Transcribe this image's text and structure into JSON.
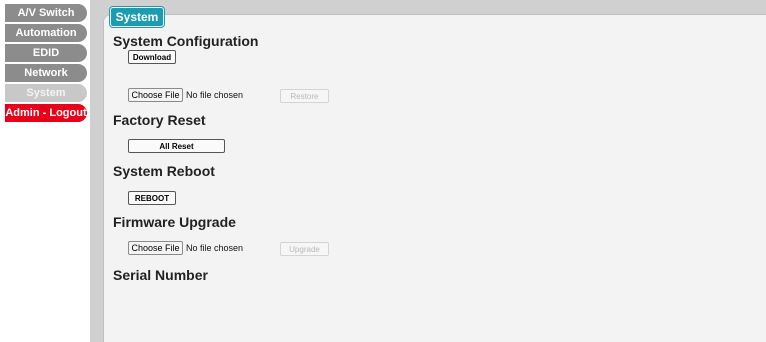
{
  "sidebar": {
    "items": [
      {
        "label": "A/V Switch"
      },
      {
        "label": "Automation"
      },
      {
        "label": "EDID"
      },
      {
        "label": "Network"
      },
      {
        "label": "System"
      },
      {
        "label": "Admin - Logout"
      }
    ]
  },
  "page": {
    "tab_title": "System"
  },
  "system_configuration": {
    "heading": "System Configuration",
    "download_label": "Download",
    "choose_file_label": "Choose File",
    "file_status": "No file chosen",
    "restore_label": "Restore"
  },
  "factory_reset": {
    "heading": "Factory Reset",
    "all_reset_label": "All Reset"
  },
  "system_reboot": {
    "heading": "System Reboot",
    "reboot_label": "REBOOT"
  },
  "firmware_upgrade": {
    "heading": "Firmware Upgrade",
    "choose_file_label": "Choose File",
    "file_status": "No file chosen",
    "upgrade_label": "Upgrade"
  },
  "serial_number": {
    "heading": "Serial Number"
  },
  "colors": {
    "accent": "#1b9cb0",
    "logout": "#e8001a",
    "nav_dark": "#8c8c8c",
    "nav_active": "#c8c8c8"
  }
}
